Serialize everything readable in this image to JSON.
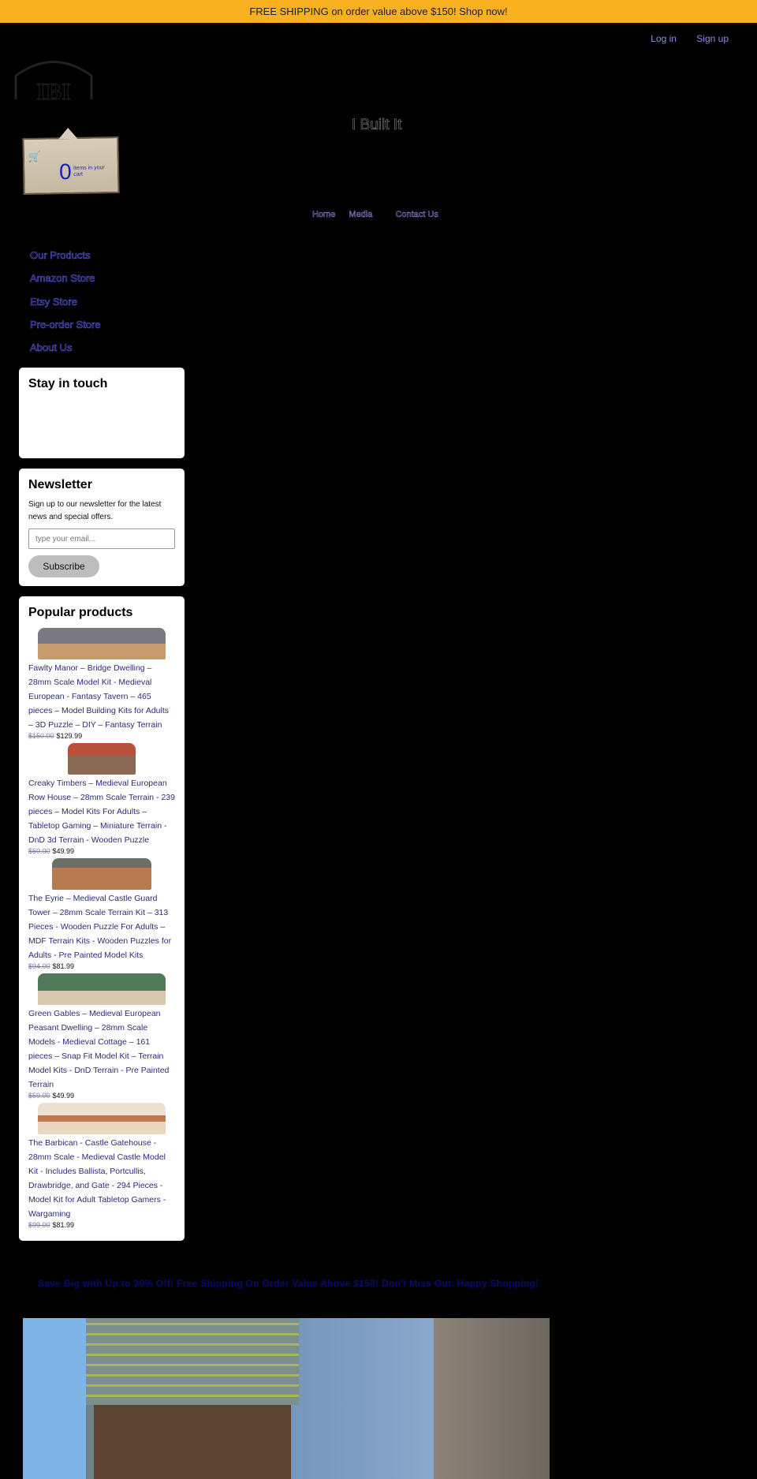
{
  "banner": {
    "text": "FREE SHIPPING on order value above $150! Shop now!",
    "color": "#f9b11f"
  },
  "auth": {
    "login": "Log in",
    "signup": "Sign up"
  },
  "site": {
    "title": "I Built It",
    "logo_text": "I Built It"
  },
  "cart": {
    "count": "0",
    "label": "items in your cart",
    "icon": "cart-icon"
  },
  "topnav": [
    {
      "label": "Home"
    },
    {
      "label": "Media"
    },
    {
      "label": "Contact Us"
    }
  ],
  "sidenav": [
    {
      "label": "Our Products"
    },
    {
      "label": "Amazon Store"
    },
    {
      "label": "Etsy Store"
    },
    {
      "label": "Pre-order Store"
    },
    {
      "label": "About Us"
    }
  ],
  "stay": {
    "title": "Stay in touch"
  },
  "newsletter": {
    "title": "Newsletter",
    "text": "Sign up to our newsletter for the latest news and special offers.",
    "placeholder": "type your email...",
    "button": "Subscribe"
  },
  "popular": {
    "title": "Popular products",
    "items": [
      {
        "title": "Fawlty Manor – Bridge Dwelling – 28mm Scale Model Kit - Medieval European - Fantasy Tavern – 465 pieces – Model Building Kits for Adults – 3D Puzzle – DIY – Fantasy Terrain",
        "old": "$150.00",
        "price": "$129.99"
      },
      {
        "title": "Creaky Timbers – Medieval European Row House – 28mm Scale Terrain - 239 pieces – Model Kits For Adults – Tabletop Gaming – Miniature Terrain - DnD 3d Terrain - Wooden Puzzle",
        "old": "$60.00",
        "price": "$49.99"
      },
      {
        "title": "The Eyrie – Medieval Castle Guard Tower – 28mm Scale Terrain Kit – 313 Pieces - Wooden Puzzle For Adults – MDF Terrain Kits - Wooden Puzzles for Adults - Pre Painted Model Kits",
        "old": "$94.00",
        "price": "$81.99"
      },
      {
        "title": "Green Gables – Medieval European Peasant Dwelling – 28mm Scale Models - Medieval Cottage – 161 pieces – Snap Fit Model Kit – Terrain Model Kits - DnD Terrain - Pre Painted Terrain",
        "old": "$59.00",
        "price": "$49.99"
      },
      {
        "title": "The Barbican - Castle Gatehouse - 28mm Scale - Medieval Castle Model Kit - Includes Ballista, Portcullis, Drawbridge, and Gate - 294 Pieces - Model Kit for Adult Tabletop Gamers - Wargaming",
        "old": "$99.00",
        "price": "$81.99"
      }
    ]
  },
  "promo": {
    "text": "Save Big with Up to 30% Off! Free Shipping On Order Value Above $150! Don't Miss Out. Happy Shopping!"
  }
}
